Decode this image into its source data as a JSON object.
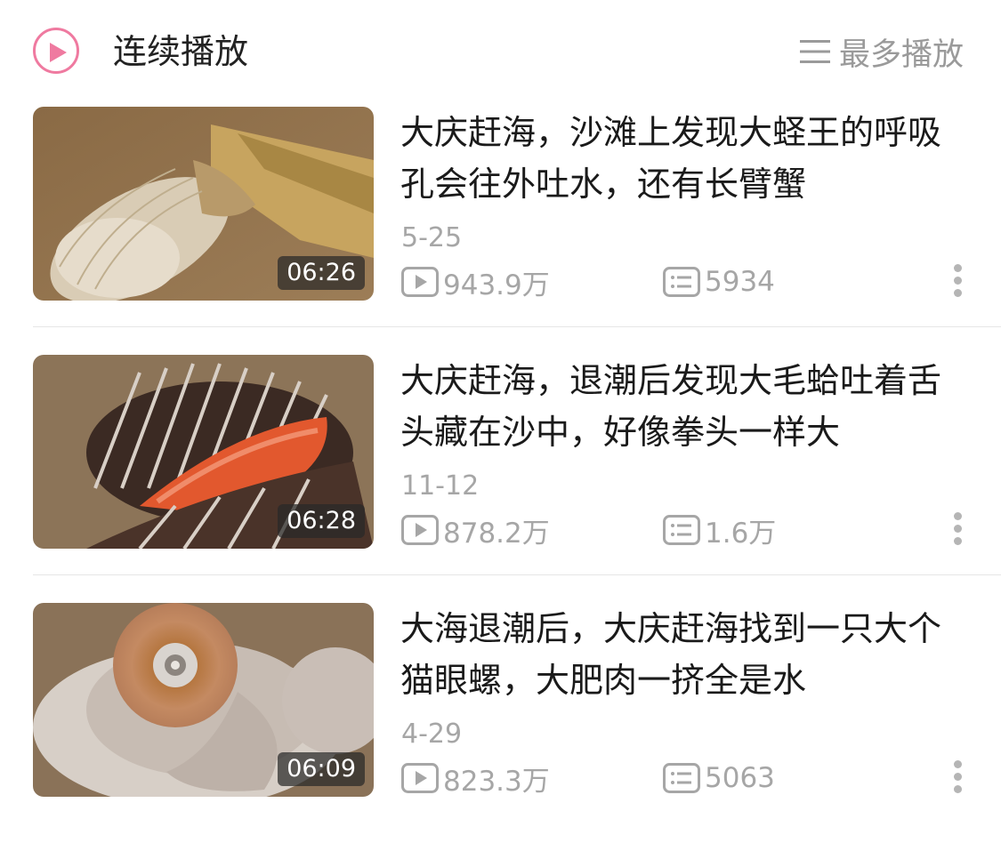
{
  "header": {
    "title": "连续播放",
    "sort_label": "最多播放",
    "accent": "#ef7aa0"
  },
  "videos": [
    {
      "title": "大庆赶海，沙滩上发现大蛏王的呼吸孔会往外吐水，还有长臂蟹",
      "duration": "06:26",
      "date": "5-25",
      "views": "943.9万",
      "comments": "5934",
      "icon": "play-icon"
    },
    {
      "title": "大庆赶海，退潮后发现大毛蛤吐着舌头藏在沙中，好像拳头一样大",
      "duration": "06:28",
      "date": "11-12",
      "views": "878.2万",
      "comments": "1.6万",
      "icon": "play-icon"
    },
    {
      "title": "大海退潮后，大庆赶海找到一只大个猫眼螺，大肥肉一挤全是水",
      "duration": "06:09",
      "date": "4-29",
      "views": "823.3万",
      "comments": "5063",
      "icon": "play-icon"
    }
  ]
}
